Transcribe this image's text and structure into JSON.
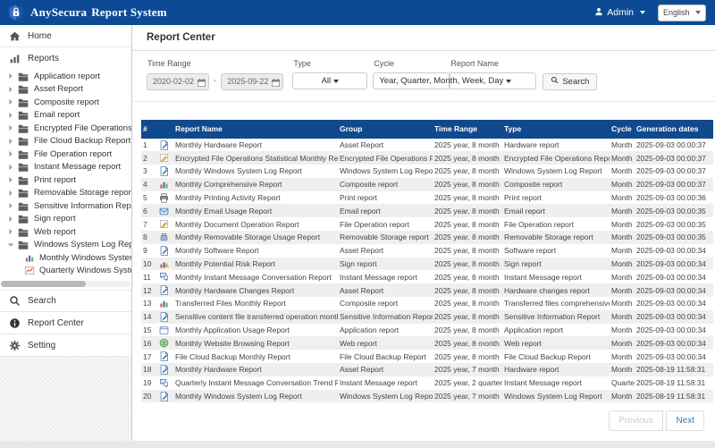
{
  "header": {
    "brand_name": "AnySecura",
    "brand_suffix": "Report System",
    "logo_icon": "shield-lock-icon",
    "user_label": "Admin",
    "language": "English"
  },
  "sidebar": {
    "items": [
      {
        "label": "Home",
        "kind": "top",
        "icon": "home-icon"
      },
      {
        "label": "Reports",
        "kind": "top",
        "icon": "reports-icon"
      },
      {
        "label": "Application report",
        "kind": "folder",
        "icon": "folder-icon"
      },
      {
        "label": "Asset Report",
        "kind": "folder",
        "icon": "folder-icon"
      },
      {
        "label": "Composite report",
        "kind": "folder",
        "icon": "folder-icon"
      },
      {
        "label": "Email report",
        "kind": "folder",
        "icon": "folder-icon"
      },
      {
        "label": "Encrypted File Operations Report",
        "kind": "folder",
        "icon": "folder-icon"
      },
      {
        "label": "File Cloud Backup Report",
        "kind": "folder",
        "icon": "folder-icon"
      },
      {
        "label": "File Operation report",
        "kind": "folder",
        "icon": "folder-icon"
      },
      {
        "label": "Instant Message report",
        "kind": "folder",
        "icon": "folder-icon"
      },
      {
        "label": "Print report",
        "kind": "folder",
        "icon": "folder-icon"
      },
      {
        "label": "Removable Storage report",
        "kind": "folder",
        "icon": "folder-icon"
      },
      {
        "label": "Sensitive Information Report",
        "kind": "folder",
        "icon": "folder-icon"
      },
      {
        "label": "Sign report",
        "kind": "folder",
        "icon": "folder-icon"
      },
      {
        "label": "Web report",
        "kind": "folder",
        "icon": "folder-icon"
      },
      {
        "label": "Windows System Log Report",
        "kind": "folder-open",
        "icon": "folder-icon"
      },
      {
        "label": "Monthly Windows System Log Report",
        "kind": "leaf",
        "icon": "bar-chart-icon"
      },
      {
        "label": "Quarterly Windows System Log Report",
        "kind": "leaf",
        "icon": "line-chart-icon"
      },
      {
        "label": "Search",
        "kind": "top",
        "icon": "search-icon"
      },
      {
        "label": "Report Center",
        "kind": "top",
        "icon": "info-icon"
      },
      {
        "label": "Setting",
        "kind": "top",
        "icon": "gear-icon"
      }
    ]
  },
  "page_title": "Report Center",
  "filters": {
    "time_range": {
      "label": "Time Range",
      "from": "2020-02-02",
      "to": "2025-09-22",
      "separator": "-"
    },
    "type": {
      "label": "Type",
      "value": "All"
    },
    "cycle": {
      "label": "Cycle",
      "value": "Year, Quarter, Month, Week, Day"
    },
    "report_name": {
      "label": "Report Name",
      "value": ""
    },
    "search_label": "Search"
  },
  "table": {
    "columns": [
      "#",
      "Report Name",
      "Group",
      "Time Range",
      "Type",
      "Cycle",
      "Generation dates"
    ],
    "rows": [
      {
        "num": "1",
        "icon": "doc-edit-icon",
        "name": "Monthly Hardware Report",
        "group": "Asset Report",
        "time_range": "2025 year, 8 month",
        "type": "Hardware report",
        "cycle": "Month",
        "generated": "2025-09-03 00:00:37"
      },
      {
        "num": "2",
        "icon": "note-edit-icon",
        "name": "Encrypted File Operations Statistical Monthly Report",
        "group": "Encrypted File Operations Report",
        "time_range": "2025 year, 8 month",
        "type": "Encrypted File Operations Report",
        "cycle": "Month",
        "generated": "2025-09-03 00:00:37"
      },
      {
        "num": "3",
        "icon": "doc-edit-icon",
        "name": "Monthly Windows System Log Report",
        "group": "Windows System Log Report",
        "time_range": "2025 year, 8 month",
        "type": "Windows System Log Report",
        "cycle": "Month",
        "generated": "2025-09-03 00:00:37"
      },
      {
        "num": "4",
        "icon": "bar-chart-icon",
        "name": "Monthly Comprehensive Report",
        "group": "Composite report",
        "time_range": "2025 year, 8 month",
        "type": "Composite report",
        "cycle": "Month",
        "generated": "2025-09-03 00:00:37"
      },
      {
        "num": "5",
        "icon": "printer-icon",
        "name": "Monthly Printing Activity Report",
        "group": "Print report",
        "time_range": "2025 year, 8 month",
        "type": "Print report",
        "cycle": "Month",
        "generated": "2025-09-03 00:00:36"
      },
      {
        "num": "6",
        "icon": "mail-icon",
        "name": "Monthly Email Usage Report",
        "group": "Email report",
        "time_range": "2025 year, 8 month",
        "type": "Email report",
        "cycle": "Month",
        "generated": "2025-09-03 00:00:35"
      },
      {
        "num": "7",
        "icon": "note-edit-icon",
        "name": "Monthly Document Operation Report",
        "group": "File Operation report",
        "time_range": "2025 year, 8 month",
        "type": "File Operation report",
        "cycle": "Month",
        "generated": "2025-09-03 00:00:35"
      },
      {
        "num": "8",
        "icon": "storage-icon",
        "name": "Monthly Removable Storage Usage Report",
        "group": "Removable Storage report",
        "time_range": "2025 year, 8 month",
        "type": "Removable Storage report",
        "cycle": "Month",
        "generated": "2025-09-03 00:00:35"
      },
      {
        "num": "9",
        "icon": "doc-edit-icon",
        "name": "Monthly Software Report",
        "group": "Asset Report",
        "time_range": "2025 year, 8 month",
        "type": "Software report",
        "cycle": "Month",
        "generated": "2025-09-03 00:00:34"
      },
      {
        "num": "10",
        "icon": "risk-chart-icon",
        "name": "Monthly Potential Risk Report",
        "group": "Sign report",
        "time_range": "2025 year, 8 month",
        "type": "Sign report",
        "cycle": "Month",
        "generated": "2025-09-03 00:00:34"
      },
      {
        "num": "11",
        "icon": "chat-icon",
        "name": "Monthly Instant Message Conversation Report",
        "group": "Instant Message report",
        "time_range": "2025 year, 8 month",
        "type": "Instant Message report",
        "cycle": "Month",
        "generated": "2025-09-03 00:00:34"
      },
      {
        "num": "12",
        "icon": "doc-edit-icon",
        "name": "Monthly Hardware Changes Report",
        "group": "Asset Report",
        "time_range": "2025 year, 8 month",
        "type": "Hardware changes report",
        "cycle": "Month",
        "generated": "2025-09-03 00:00:34"
      },
      {
        "num": "13",
        "icon": "bar-chart-icon",
        "name": "Transferred Files Monthly Report",
        "group": "Composite report",
        "time_range": "2025 year, 8 month",
        "type": "Transferred files comprehensive report",
        "cycle": "Month",
        "generated": "2025-09-03 00:00:34"
      },
      {
        "num": "14",
        "icon": "doc-edit-icon",
        "name": "Sensitive content file transferred operation monthly report",
        "group": "Sensitive Information Report",
        "time_range": "2025 year, 8 month",
        "type": "Sensitive Information Report",
        "cycle": "Month",
        "generated": "2025-09-03 00:00:34"
      },
      {
        "num": "15",
        "icon": "app-window-icon",
        "name": "Monthly Application Usage Report",
        "group": "Application report",
        "time_range": "2025 year, 8 month",
        "type": "Application report",
        "cycle": "Month",
        "generated": "2025-09-03 00:00:34"
      },
      {
        "num": "16",
        "icon": "globe-icon",
        "name": "Monthly Website Browsing Report",
        "group": "Web report",
        "time_range": "2025 year, 8 month",
        "type": "Web report",
        "cycle": "Month",
        "generated": "2025-09-03 00:00:34"
      },
      {
        "num": "17",
        "icon": "doc-edit-icon",
        "name": "File Cloud Backup Monthly Report",
        "group": "File Cloud Backup Report",
        "time_range": "2025 year, 8 month",
        "type": "File Cloud Backup Report",
        "cycle": "Month",
        "generated": "2025-09-03 00:00:34"
      },
      {
        "num": "18",
        "icon": "doc-edit-icon",
        "name": "Monthly Hardware Report",
        "group": "Asset Report",
        "time_range": "2025 year, 7 month",
        "type": "Hardware report",
        "cycle": "Month",
        "generated": "2025-08-19 11:58:31"
      },
      {
        "num": "19",
        "icon": "chat-icon",
        "name": "Quarterly Instant Message Conversation Trend Report",
        "group": "Instant Message report",
        "time_range": "2025 year, 2 quarter",
        "type": "Instant Message report",
        "cycle": "Quarter",
        "generated": "2025-08-19 11:58:31"
      },
      {
        "num": "20",
        "icon": "doc-edit-icon",
        "name": "Monthly Windows System Log Report",
        "group": "Windows System Log Report",
        "time_range": "2025 year, 7 month",
        "type": "Windows System Log Report",
        "cycle": "Month",
        "generated": "2025-08-19 11:58:31"
      }
    ]
  },
  "pagination": {
    "previous": "Previous",
    "next": "Next"
  },
  "colors": {
    "header_blue": "#0d4a95",
    "table_header_blue": "#11498e",
    "link_blue": "#337ab7"
  }
}
